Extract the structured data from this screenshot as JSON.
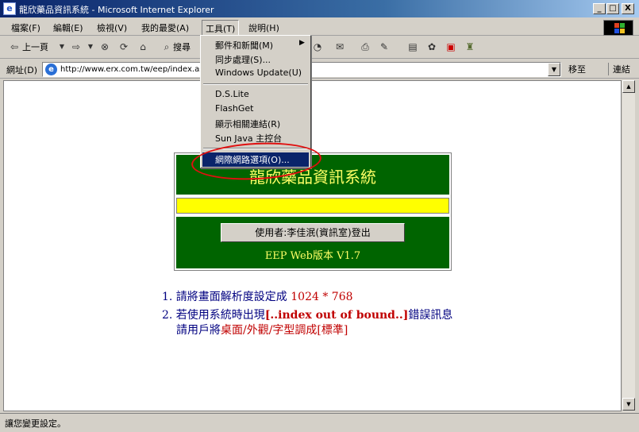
{
  "window": {
    "title": "龍欣藥品資訊系統 - Microsoft Internet Explorer",
    "btn_min": "_",
    "btn_max": "□",
    "btn_close": "X"
  },
  "menu": {
    "items": [
      "檔案(F)",
      "編輯(E)",
      "檢視(V)",
      "我的最愛(A)",
      "工具(T)",
      "說明(H)"
    ]
  },
  "toolbar": {
    "back_label": "上一頁",
    "search_label": "搜尋"
  },
  "address": {
    "label": "網址(D)",
    "url": "http://www.erx.com.tw/eep/index.asp",
    "go_label": "移至",
    "links_label": "連結"
  },
  "tools_menu": {
    "items": [
      "郵件和新聞(M)",
      "同步處理(S)...",
      "Windows Update(U)",
      "D.S.Lite",
      "FlashGet",
      "顯示相關連結(R)",
      "Sun Java 主控台",
      "網際網路選項(O)..."
    ]
  },
  "app": {
    "title": "龍欣藥品資訊系統",
    "login_button": "使用者:李佳泯(資訊室)登出",
    "version": "EEP Web版本 V1.7"
  },
  "notes": {
    "line1_prefix": "1. 請將畫面解析度設定成 ",
    "line1_value": "1024 * 768",
    "line2_prefix": "2. 若使用系統時出現",
    "line2_error": "[..index out of bound..]",
    "line2_suffix": "錯誤訊息",
    "line3_prefix": "請用戶將",
    "line3_path": "桌面/外觀/字型調成[標準]"
  },
  "status": {
    "text": "讓您變更設定。"
  },
  "colors": {
    "panel_green": "#006400",
    "title_yellow": "#ffff66",
    "bar_yellow": "#ffff00",
    "note_blue": "#000080",
    "note_red": "#c00000",
    "highlight_red": "#e01010"
  }
}
